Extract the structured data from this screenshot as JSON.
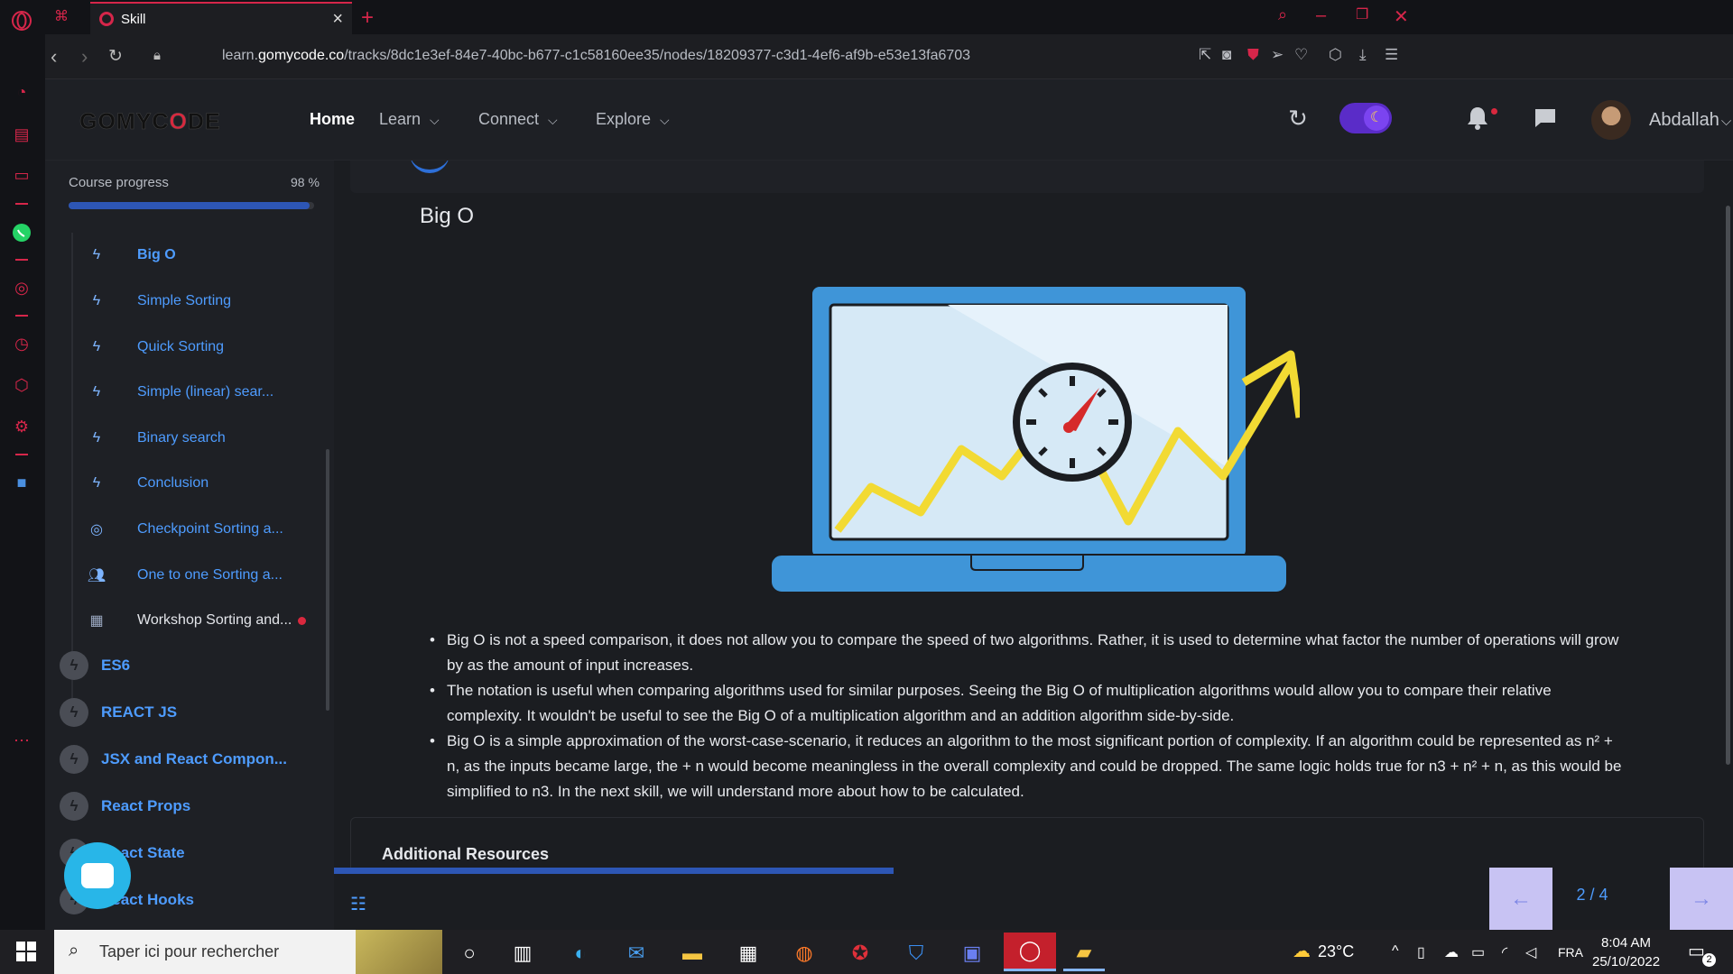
{
  "browser": {
    "tab_title": "Skill",
    "url_prefix": "learn.",
    "url_host": "gomycode.co",
    "url_path": "/tracks/8dc1e3ef-84e7-40bc-b677-c1c58160ee35/nodes/18209377-c3d1-4ef6-af9b-e53e13fa6703"
  },
  "header": {
    "logo_pre": "GOMYC",
    "logo_o": "O",
    "logo_post": "DE",
    "nav": [
      {
        "label": "Home"
      },
      {
        "label": "Learn"
      },
      {
        "label": "Connect"
      },
      {
        "label": "Explore"
      }
    ],
    "username": "Abdallah"
  },
  "sidebar": {
    "progress_label": "Course progress",
    "progress_value": "98 %",
    "progress_fraction": 0.98,
    "sub_items": [
      {
        "label": "Big O",
        "icon": "lightning-icon"
      },
      {
        "label": "Simple Sorting",
        "icon": "lightning-icon"
      },
      {
        "label": "Quick Sorting",
        "icon": "lightning-icon"
      },
      {
        "label": "Simple (linear) sear...",
        "icon": "lightning-icon"
      },
      {
        "label": "Binary search",
        "icon": "lightning-icon"
      },
      {
        "label": "Conclusion",
        "icon": "lightning-icon"
      },
      {
        "label": "Checkpoint Sorting a...",
        "icon": "target-icon"
      },
      {
        "label": "One to one Sorting a...",
        "icon": "people-icon"
      },
      {
        "label": "Workshop Sorting and...",
        "icon": "workshop-icon"
      }
    ],
    "modules": [
      {
        "label": "ES6"
      },
      {
        "label": "REACT JS"
      },
      {
        "label": "JSX and React Compon..."
      },
      {
        "label": "React Props"
      },
      {
        "label": "React State"
      },
      {
        "label": "React Hooks"
      }
    ]
  },
  "lesson": {
    "title": "Big O",
    "bullets": [
      "Big O is not a speed comparison, it does not allow you to compare the speed of two algorithms. Rather, it is used to determine what factor the number of operations will grow by as the amount of input increases.",
      "The notation is useful when comparing algorithms used for similar purposes. Seeing the Big O of multiplication algorithms would allow you to compare their relative complexity. It wouldn't be useful to see the Big O of a multiplication algorithm and an addition algorithm side-by-side.",
      "Big O is a simple approximation of the worst-case-scenario, it reduces an algorithm to the most significant portion of complexity. If an algorithm could be represented as n² + n, as the inputs became large, the + n would become meaningless in the overall complexity and could be dropped. The same logic holds true for n3 + n² + n, as this would be simplified to n3. In the next skill, we will understand more about how to be calculated."
    ],
    "resources_title": "Additional Resources",
    "pager": "2 / 4",
    "lesson_progress_fraction": 0.4
  },
  "taskbar": {
    "search_placeholder": "Taper ici pour rechercher",
    "weather": "23°C",
    "lang": "FRA",
    "time": "8:04 AM",
    "date": "25/10/2022",
    "notif_count": "2"
  },
  "colors": {
    "accent_red": "#d6264a",
    "link_blue": "#4e9cff",
    "progress_blue": "#2d56b5",
    "pager_bg": "#c8c3f3"
  }
}
